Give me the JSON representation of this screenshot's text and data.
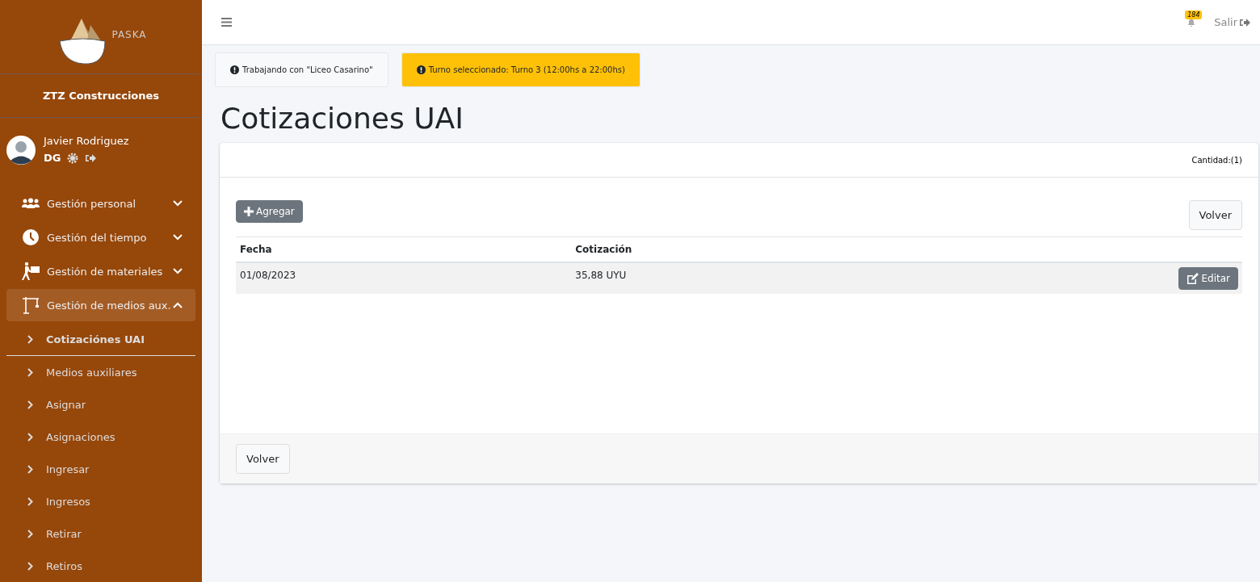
{
  "brand": {
    "logo_text": "PASKA",
    "company": "ZTZ Construcciones"
  },
  "user": {
    "name": "Javier Rodriguez",
    "role": "DG"
  },
  "menu": [
    {
      "label": "Gestión personal",
      "expanded": false
    },
    {
      "label": "Gestión del tiempo",
      "expanded": false
    },
    {
      "label": "Gestión de materiales",
      "expanded": false
    },
    {
      "label": "Gestión de medios aux.",
      "expanded": true,
      "children": [
        {
          "label": "Cotizaciónes UAI",
          "selected": true
        },
        {
          "label": "Medios auxiliares",
          "selected": false
        },
        {
          "label": "Asignar",
          "selected": false
        },
        {
          "label": "Asignaciones",
          "selected": false
        },
        {
          "label": "Ingresar",
          "selected": false
        },
        {
          "label": "Ingresos",
          "selected": false
        },
        {
          "label": "Retirar",
          "selected": false
        },
        {
          "label": "Retiros",
          "selected": false
        }
      ]
    }
  ],
  "topbar": {
    "notification_count": "184",
    "logout": "Salir"
  },
  "alerts": [
    {
      "text": "Trabajando con \"Liceo Casarino\"",
      "color": "#f8f9fa"
    },
    {
      "text": "Turno seleccionado: Turno 3 (12:00hs a 22:00hs)",
      "color": "#ffc107"
    }
  ],
  "page_title": "Cotizaciones UAI",
  "card": {
    "count": "Cantidad:(1)",
    "add_button": "Agregar",
    "back_button_top": "Volver",
    "back_button_bottom": "Volver",
    "table": {
      "columns": [
        "Fecha",
        "Cotización"
      ],
      "rows": [
        {
          "cells": [
            "01/08/2023",
            "35,88 UYU"
          ],
          "action": "Editar"
        }
      ]
    }
  }
}
